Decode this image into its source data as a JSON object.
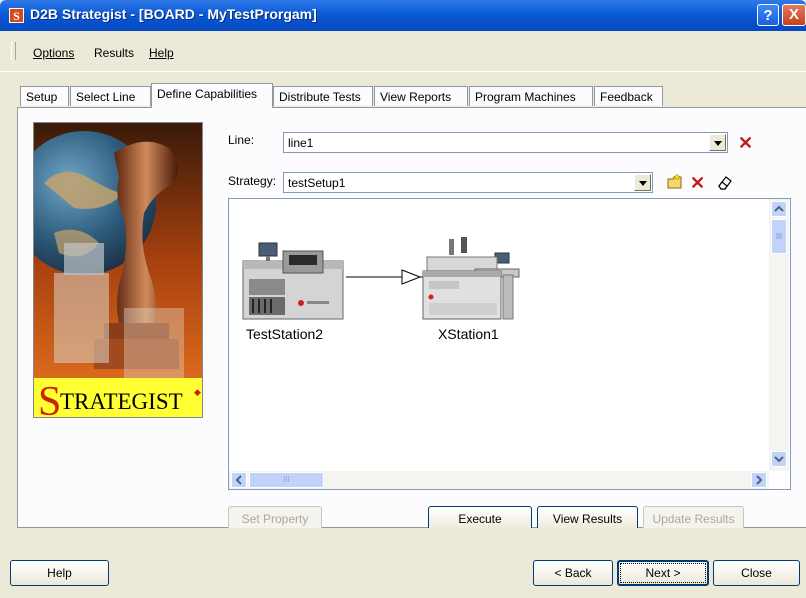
{
  "window": {
    "icon_letter": "S",
    "title": "D2B Strategist - [BOARD - MyTestProrgam]",
    "help_glyph": "?",
    "close_glyph": "X"
  },
  "menu": {
    "items": [
      {
        "label": "Options",
        "underline": "O"
      },
      {
        "label": "Results",
        "underline": ""
      },
      {
        "label": "Help",
        "underline": "H"
      }
    ]
  },
  "tabs": [
    {
      "label": "Setup",
      "active": false
    },
    {
      "label": "Select Line",
      "active": false
    },
    {
      "label": "Define Capabilities",
      "active": true
    },
    {
      "label": "Distribute Tests",
      "active": false
    },
    {
      "label": "View Reports",
      "active": false
    },
    {
      "label": "Program Machines",
      "active": false
    },
    {
      "label": "Feedback",
      "active": false
    }
  ],
  "logo": {
    "text_first": "S",
    "text_rest": "TRATEGIST",
    "colors": {
      "band": "#ffff33",
      "s": "#cc2200"
    }
  },
  "form": {
    "line_label": "Line:",
    "line_value": "line1",
    "strategy_label": "Strategy:",
    "strategy_value": "testSetup1"
  },
  "canvas": {
    "stations": [
      {
        "name": "TestStation2"
      },
      {
        "name": "XStation1"
      }
    ],
    "hscroll_grip": "III"
  },
  "actions": {
    "set_property": {
      "label": "Set Property",
      "mnemonic": "t",
      "enabled": false
    },
    "execute": {
      "label": "Execute",
      "mnemonic": "E",
      "enabled": true
    },
    "view_results": {
      "label": "View Results",
      "mnemonic": "V",
      "enabled": true
    },
    "update_results": {
      "label": "Update Results",
      "mnemonic": "U",
      "enabled": false
    }
  },
  "footer": {
    "help": "Help",
    "back": "< Back",
    "next": "Next >",
    "close": "Close"
  },
  "colors": {
    "titlebar": "#0a5bd6",
    "accent_red": "#c01d1d"
  }
}
